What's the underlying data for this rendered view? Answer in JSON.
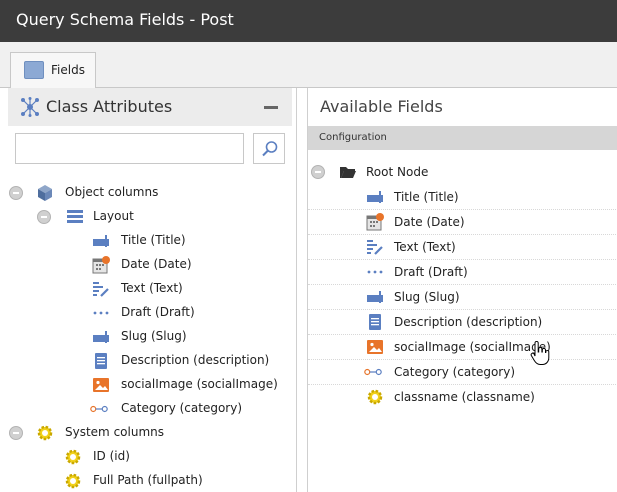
{
  "window": {
    "title": "Query Schema Fields - Post"
  },
  "tabs": [
    {
      "label": "Fields"
    }
  ],
  "left_panel": {
    "title": "Class Attributes",
    "search": {
      "value": "",
      "placeholder": ""
    },
    "tree": {
      "object_columns": "Object columns",
      "layout": "Layout",
      "layout_fields": [
        {
          "label": "Title (Title)",
          "icon": "input-field-icon"
        },
        {
          "label": "Date (Date)",
          "icon": "calendar-icon"
        },
        {
          "label": "Text (Text)",
          "icon": "text-edit-icon"
        },
        {
          "label": "Draft (Draft)",
          "icon": "dots-icon"
        },
        {
          "label": "Slug (Slug)",
          "icon": "input-field-icon"
        },
        {
          "label": "Description (description)",
          "icon": "document-icon"
        },
        {
          "label": "socialImage (socialImage)",
          "icon": "image-icon"
        },
        {
          "label": "Category (category)",
          "icon": "relation-icon"
        }
      ],
      "system_columns": "System columns",
      "system_fields": [
        {
          "label": "ID (id)",
          "icon": "gear-icon"
        },
        {
          "label": "Full Path (fullpath)",
          "icon": "gear-icon"
        }
      ]
    }
  },
  "right_panel": {
    "title": "Available Fields",
    "section": "Configuration",
    "root": "Root Node",
    "fields": [
      {
        "label": "Title (Title)",
        "icon": "input-field-icon"
      },
      {
        "label": "Date (Date)",
        "icon": "calendar-icon"
      },
      {
        "label": "Text (Text)",
        "icon": "text-edit-icon"
      },
      {
        "label": "Draft (Draft)",
        "icon": "dots-icon"
      },
      {
        "label": "Slug (Slug)",
        "icon": "input-field-icon"
      },
      {
        "label": "Description (description)",
        "icon": "document-icon"
      },
      {
        "label": "socialImage (socialImage)",
        "icon": "image-icon"
      },
      {
        "label": "Category (category)",
        "icon": "relation-icon"
      },
      {
        "label": "classname (classname)",
        "icon": "gear-icon"
      }
    ]
  },
  "colors": {
    "titlebar": "#3c3c3c",
    "field_icon_blue": "#5b7fc1",
    "image_icon_orange": "#e8742a",
    "gear_yellow": "#f2d21b"
  }
}
